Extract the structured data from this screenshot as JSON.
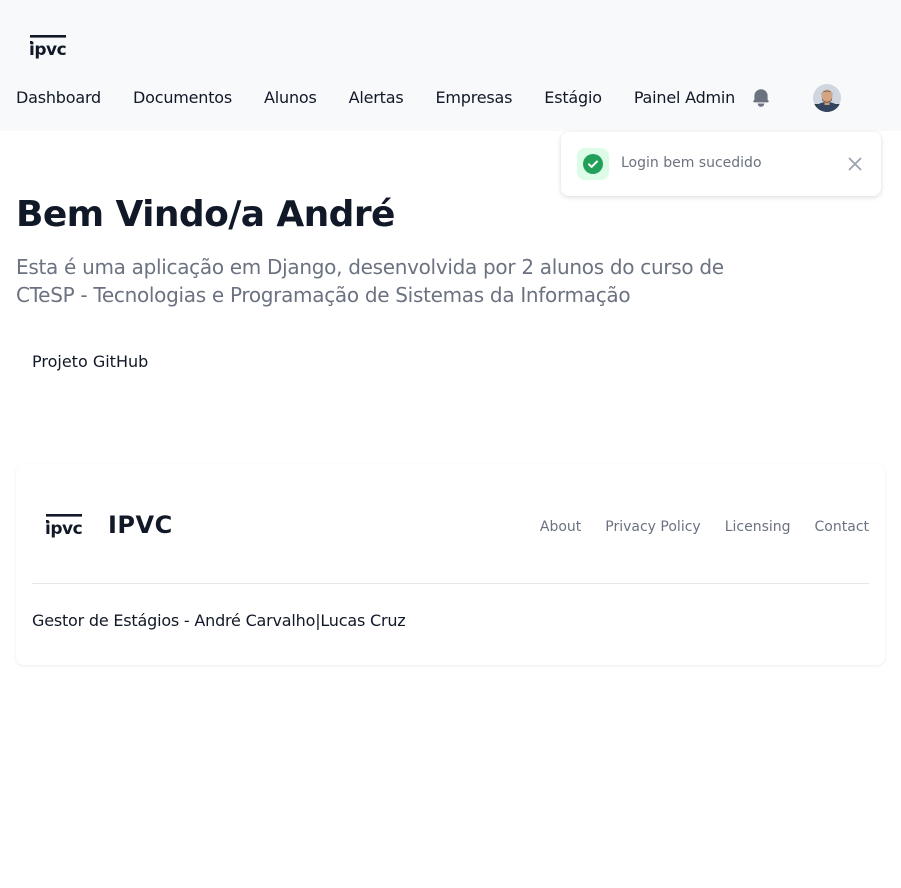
{
  "header": {
    "logo_text": "ipvc",
    "nav": [
      {
        "label": "Dashboard"
      },
      {
        "label": "Documentos"
      },
      {
        "label": "Alunos"
      },
      {
        "label": "Alertas"
      },
      {
        "label": "Empresas"
      },
      {
        "label": "Estágio"
      },
      {
        "label": "Painel Admin"
      }
    ],
    "notifications_icon": "bell-icon",
    "avatar_icon": "user-avatar"
  },
  "toast": {
    "icon": "check-circle-icon",
    "message": "Login bem sucedido",
    "close_icon": "close-icon",
    "accent_color": "#22a05a"
  },
  "hero": {
    "title": "Bem Vindo/a André",
    "subtitle": "Esta é uma aplicação em Django, desenvolvida por 2 alunos do curso de CTeSP - Tecnologias e Programação de Sistemas da Informação",
    "github_link": "Projeto GitHub"
  },
  "footer": {
    "logo_text": "ipvc",
    "brand": "IPVC",
    "links": [
      {
        "label": "About"
      },
      {
        "label": "Privacy Policy"
      },
      {
        "label": "Licensing"
      },
      {
        "label": "Contact"
      }
    ],
    "copyright": "Gestor de Estágios - André Carvalho|Lucas Cruz"
  }
}
